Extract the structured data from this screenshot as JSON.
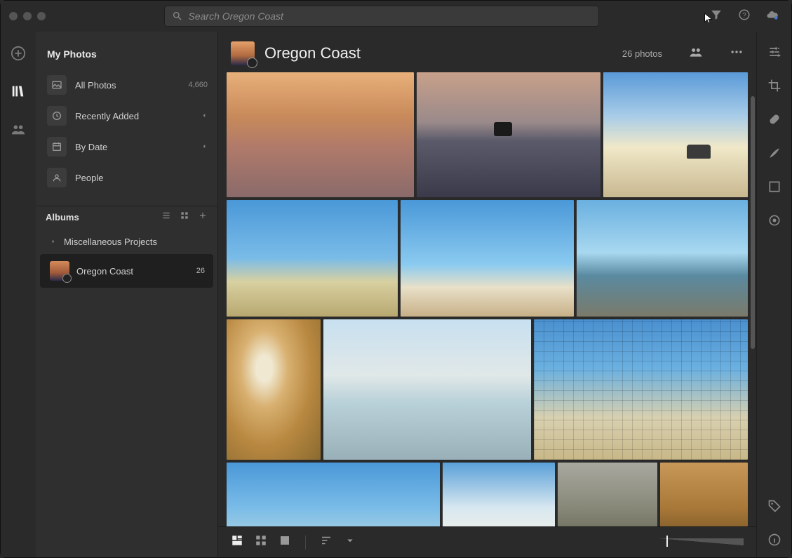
{
  "search": {
    "placeholder": "Search Oregon Coast"
  },
  "sidebar": {
    "section_title": "My Photos",
    "items": [
      {
        "label": "All Photos",
        "count": "4,660"
      },
      {
        "label": "Recently Added"
      },
      {
        "label": "By Date"
      },
      {
        "label": "People"
      }
    ],
    "albums_label": "Albums",
    "albums": [
      {
        "label": "Miscellaneous Projects"
      },
      {
        "label": "Oregon Coast",
        "count": "26",
        "selected": true
      }
    ]
  },
  "header": {
    "title": "Oregon Coast",
    "count_label": "26 photos"
  },
  "icons": {
    "add": "add-icon",
    "library": "library-icon",
    "shared": "shared-icon",
    "filter": "filter-icon",
    "help": "help-icon",
    "cloud": "cloud-icon",
    "sliders": "sliders-icon",
    "crop": "crop-icon",
    "heal": "heal-icon",
    "brush": "brush-icon",
    "radial": "square-icon",
    "circular": "circle-icon",
    "tag": "tag-icon",
    "info": "info-icon"
  }
}
